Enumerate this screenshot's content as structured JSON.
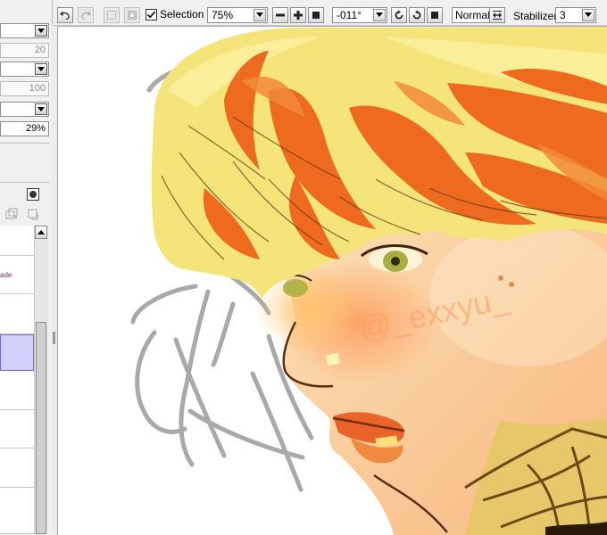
{
  "toolbar": {
    "undo": "undo-icon",
    "redo": "redo-icon",
    "deselect": "deselect-icon",
    "invert": "invert-selection-icon",
    "selection_checked": true,
    "selection_label": "Selection",
    "zoom_value": "75%",
    "rotation_value": "-011°",
    "blend_mode_label": "Normal",
    "stabilizer_label": "Stabilizer",
    "stabilizer_value": "3"
  },
  "left_panel": {
    "field_1": "20",
    "field_2": "100",
    "opacity_value": "29%",
    "layer_mode_fragment": "ade"
  },
  "canvas": {
    "watermark": "@_exxyu_"
  }
}
